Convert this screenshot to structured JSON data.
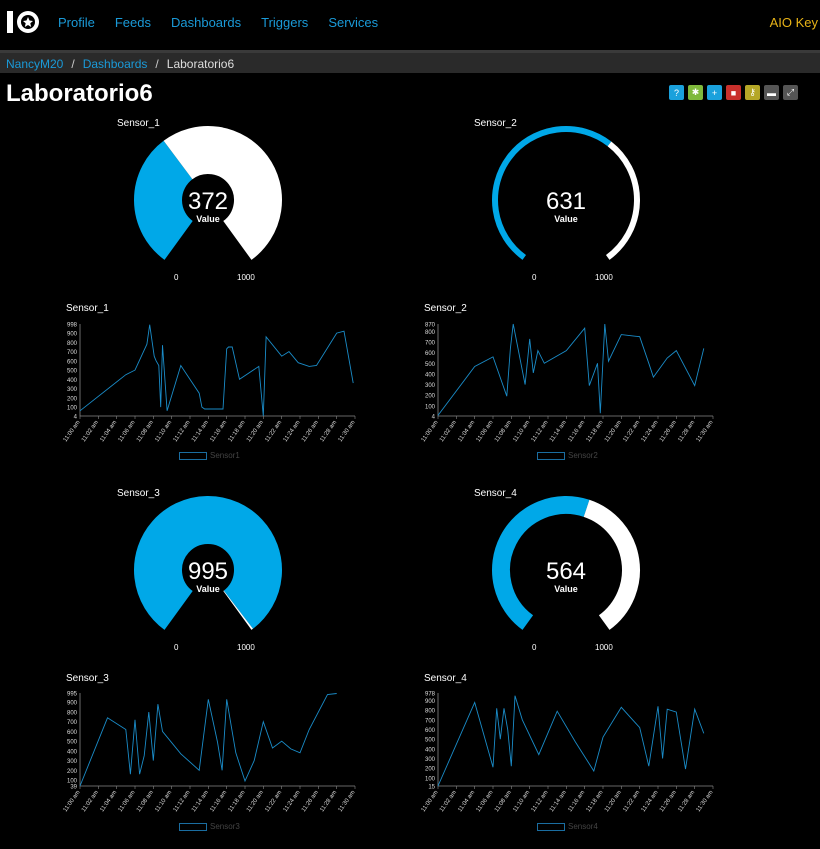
{
  "nav": {
    "links": [
      "Profile",
      "Feeds",
      "Dashboards",
      "Triggers",
      "Services"
    ],
    "aio_key": "AIO Key"
  },
  "breadcrumb": {
    "user": "NancyM20",
    "dashboards": "Dashboards",
    "current": "Laboratorio6",
    "sep": "/"
  },
  "page_title": "Laboratorio6",
  "toolbar": [
    {
      "icon": "help-icon",
      "glyph": "?",
      "color": "#1aa1dc"
    },
    {
      "icon": "gear-icon",
      "glyph": "✱",
      "color": "#7fb93b"
    },
    {
      "icon": "plus-icon",
      "glyph": "+",
      "color": "#1aa1dc"
    },
    {
      "icon": "trash-icon",
      "glyph": "■",
      "color": "#c9302c"
    },
    {
      "icon": "key-icon",
      "glyph": "⚷",
      "color": "#b5a727"
    },
    {
      "icon": "lock-icon",
      "glyph": "▬",
      "color": "#555"
    },
    {
      "icon": "expand-icon",
      "glyph": "⤢",
      "color": "#555"
    }
  ],
  "colors": {
    "accent": "#00a8e8",
    "gauge_rest": "#ffffff"
  },
  "gauges": [
    {
      "name": "Sensor_1",
      "value": 372,
      "value_text": "372",
      "sub": "Value",
      "min": "0",
      "max": "1000",
      "fraction": 0.372
    },
    {
      "name": "Sensor_2",
      "value": 631,
      "value_text": "631",
      "sub": "Value",
      "min": "0",
      "max": "1000",
      "fraction": 0.631
    },
    {
      "name": "Sensor_3",
      "value": 995,
      "value_text": "995",
      "sub": "Value",
      "min": "0",
      "max": "1000",
      "fraction": 0.995
    },
    {
      "name": "Sensor_4",
      "value": 564,
      "value_text": "564",
      "sub": "Value",
      "min": "0",
      "max": "1000",
      "fraction": 0.564
    }
  ],
  "chart_data": [
    {
      "type": "line",
      "title": "Sensor_1",
      "legend": "Sensor1",
      "yticks": [
        "998",
        "900",
        "800",
        "700",
        "600",
        "500",
        "400",
        "300",
        "200",
        "100",
        "4"
      ],
      "ytick_values": [
        998,
        900,
        800,
        700,
        600,
        500,
        400,
        300,
        200,
        100,
        4
      ],
      "ylim": [
        4,
        998
      ],
      "xticks": [
        "11:00 am",
        "11:02 am",
        "11:04 am",
        "11:06 am",
        "11:08 am",
        "11:10 am",
        "11:12 am",
        "11:14 am",
        "11:16 am",
        "11:18 am",
        "11:20 am",
        "11:22 am",
        "11:24 am",
        "11:26 am",
        "11:28 am",
        "11:30 am"
      ],
      "x": [
        0,
        5,
        6,
        7.3,
        7.6,
        8.1,
        8.3,
        8.6,
        8.8,
        9,
        9.5,
        11,
        13,
        13.3,
        13.6,
        15.6,
        16,
        16.2,
        16.6,
        17.4,
        19.5,
        20,
        20.3,
        22,
        22.8,
        23.8,
        25,
        25.8,
        28,
        28.8,
        29.8
      ],
      "y": [
        60,
        450,
        500,
        780,
        990,
        650,
        600,
        550,
        100,
        770,
        60,
        550,
        250,
        100,
        80,
        80,
        730,
        750,
        750,
        400,
        540,
        4,
        860,
        650,
        700,
        580,
        540,
        550,
        900,
        920,
        360
      ]
    },
    {
      "type": "line",
      "title": "Sensor_2",
      "legend": "Sensor2",
      "yticks": [
        "870",
        "800",
        "700",
        "600",
        "500",
        "400",
        "300",
        "200",
        "100",
        "4"
      ],
      "ytick_values": [
        870,
        800,
        700,
        600,
        500,
        400,
        300,
        200,
        100,
        4
      ],
      "ylim": [
        4,
        870
      ],
      "xticks": [
        "11:00 am",
        "11:02 am",
        "11:04 am",
        "11:06 am",
        "11:08 am",
        "11:10 am",
        "11:12 am",
        "11:14 am",
        "11:16 am",
        "11:18 am",
        "11:20 am",
        "11:22 am",
        "11:24 am",
        "11:26 am",
        "11:28 am",
        "11:30 am"
      ],
      "x": [
        0,
        4,
        6,
        7.5,
        7.9,
        8.2,
        9.5,
        10,
        10.4,
        10.9,
        11.6,
        14,
        16,
        16.5,
        17.4,
        17.7,
        18.2,
        18.6,
        20,
        22,
        23,
        23.5,
        25,
        26,
        28,
        29
      ],
      "y": [
        10,
        470,
        560,
        190,
        640,
        870,
        300,
        730,
        410,
        620,
        500,
        620,
        830,
        290,
        500,
        30,
        870,
        520,
        770,
        750,
        500,
        370,
        550,
        620,
        290,
        640
      ]
    },
    {
      "type": "line",
      "title": "Sensor_3",
      "legend": "Sensor3",
      "yticks": [
        "995",
        "900",
        "800",
        "700",
        "600",
        "500",
        "400",
        "300",
        "200",
        "100",
        "39"
      ],
      "ytick_values": [
        995,
        900,
        800,
        700,
        600,
        500,
        400,
        300,
        200,
        100,
        39
      ],
      "ylim": [
        39,
        995
      ],
      "xticks": [
        "11:00 am",
        "11:02 am",
        "11:04 am",
        "11:06 am",
        "11:08 am",
        "11:10 am",
        "11:12 am",
        "11:14 am",
        "11:16 am",
        "11:18 am",
        "11:20 am",
        "11:22 am",
        "11:24 am",
        "11:26 am",
        "11:28 am",
        "11:30 am"
      ],
      "x": [
        0,
        3,
        5,
        5.5,
        6,
        6.5,
        7,
        7.5,
        8,
        8.5,
        9,
        11,
        13,
        14,
        15,
        15.5,
        16,
        17,
        18,
        19,
        20,
        21,
        22,
        23,
        24,
        25,
        27,
        28
      ],
      "y": [
        39,
        740,
        620,
        160,
        720,
        160,
        350,
        800,
        300,
        880,
        600,
        370,
        200,
        930,
        490,
        200,
        930,
        380,
        90,
        300,
        700,
        430,
        500,
        420,
        380,
        620,
        980,
        990
      ]
    },
    {
      "type": "line",
      "title": "Sensor_4",
      "legend": "Sensor4",
      "yticks": [
        "978",
        "900",
        "800",
        "700",
        "600",
        "500",
        "400",
        "300",
        "200",
        "100",
        "15"
      ],
      "ytick_values": [
        978,
        900,
        800,
        700,
        600,
        500,
        400,
        300,
        200,
        100,
        15
      ],
      "ylim": [
        15,
        978
      ],
      "xticks": [
        "11:00 am",
        "11:02 am",
        "11:04 am",
        "11:06 am",
        "11:08 am",
        "11:10 am",
        "11:12 am",
        "11:14 am",
        "11:16 am",
        "11:18 am",
        "11:20 am",
        "11:22 am",
        "11:24 am",
        "11:26 am",
        "11:28 am",
        "11:30 am"
      ],
      "x": [
        0,
        4,
        6,
        6.4,
        6.8,
        7.2,
        7.6,
        8,
        8.4,
        9.2,
        11,
        13,
        15,
        17,
        18,
        20,
        22,
        23,
        24,
        24.5,
        25,
        26,
        27,
        28,
        29
      ],
      "y": [
        15,
        880,
        210,
        820,
        500,
        820,
        600,
        220,
        950,
        700,
        340,
        790,
        470,
        170,
        520,
        830,
        620,
        220,
        840,
        300,
        810,
        780,
        190,
        810,
        560
      ]
    }
  ]
}
